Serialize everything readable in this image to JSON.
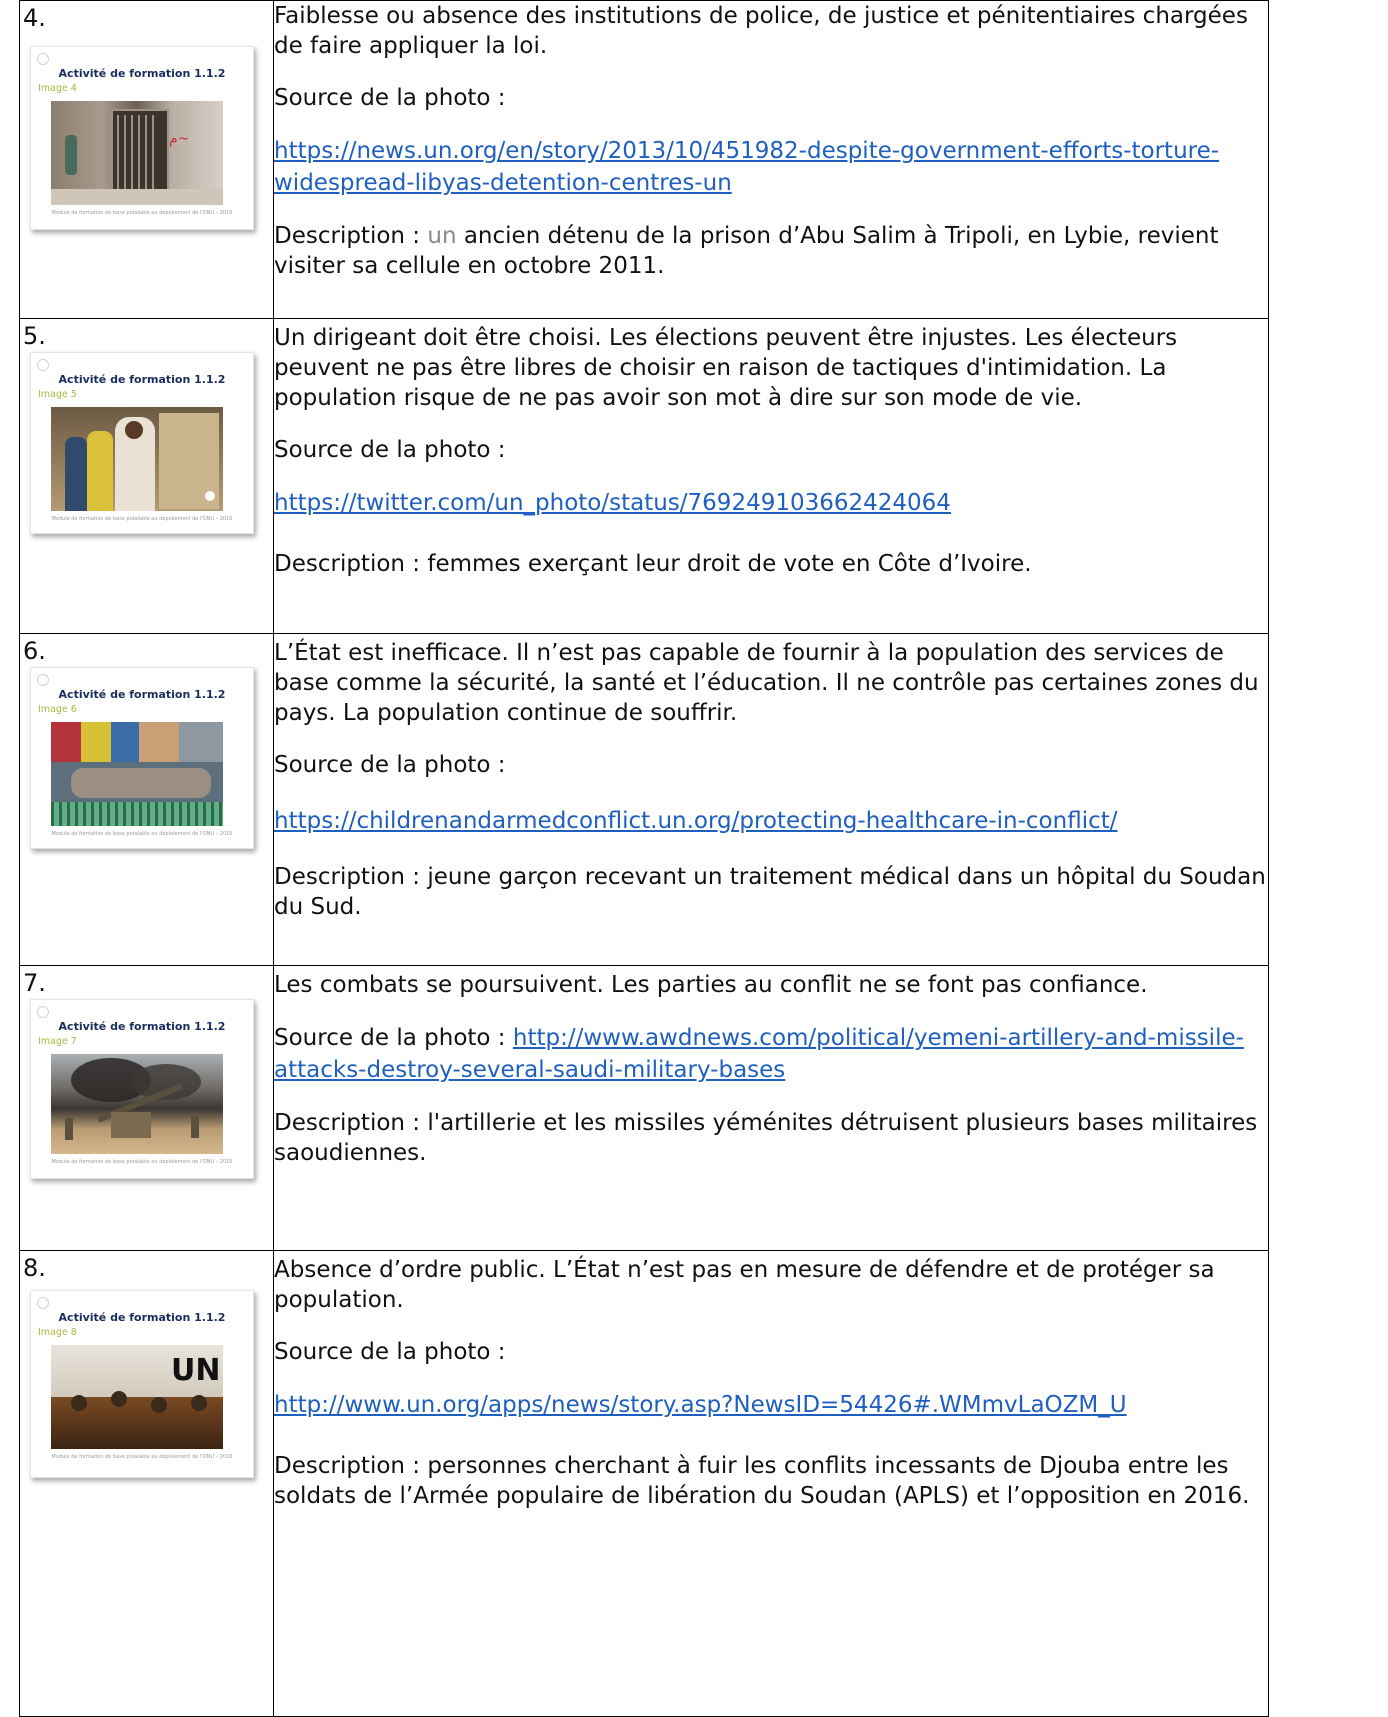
{
  "rows": [
    {
      "num": "4.",
      "slide": {
        "title": "Activité de formation 1.1.2",
        "caption": "Image 4",
        "footer": "Module de formation de base préalable au déploiement de l'ONU – 2016"
      },
      "text": "Faiblesse ou absence des institutions de police, de justice et pénitentiaires chargées de faire appliquer la loi.",
      "source_label": "Source de la photo :",
      "link": " https://news.un.org/en/story/2013/10/451982-despite-government-efforts-torture-widespread-libyas-detention-centres-un",
      "desc_prefix": "Description : ",
      "desc_gray": "un",
      "desc": " ancien détenu de la prison d’Abu Salim à Tripoli, en Lybie, revient visiter sa cellule en octobre 2011."
    },
    {
      "num": "5.",
      "slide": {
        "title": "Activité de formation 1.1.2",
        "caption": "Image 5",
        "footer": "Module de formation de base préalable au déploiement de l'ONU – 2016"
      },
      "text": "Un dirigeant doit être choisi. Les élections peuvent être injustes. Les électeurs peuvent ne pas être libres de choisir en raison de tactiques d'intimidation. La population risque de ne pas avoir son mot à dire sur son mode de vie.",
      "source_label": "Source de la photo :",
      "link": "https://twitter.com/un_photo/status/769249103662424064",
      "desc": "Description : femmes exerçant leur droit de vote en Côte d’Ivoire."
    },
    {
      "num": "6.",
      "slide": {
        "title": "Activité de formation 1.1.2",
        "caption": "Image 6",
        "footer": "Module de formation de base préalable au déploiement de l'ONU – 2016"
      },
      "text": "L’État est inefficace. Il n’est pas capable de fournir à la population des services de base comme la sécurité, la santé et l’éducation. Il ne contrôle pas certaines zones du pays. La population continue de souffrir.",
      "source_label": "Source de la photo :",
      "link": "https://childrenandarmedconflict.un.org/protecting-healthcare-in-conflict/",
      "desc": "Description : jeune garçon recevant un traitement médical dans un hôpital du Soudan du Sud."
    },
    {
      "num": "7.",
      "slide": {
        "title": "Activité de formation 1.1.2",
        "caption": "Image 7",
        "footer": "Module de formation de base préalable au déploiement de l'ONU – 2016"
      },
      "text": "Les combats se poursuivent. Les parties au conflit ne se font pas confiance.",
      "source_label": "Source de la photo :",
      "link": " http://www.awdnews.com/political/yemeni-artillery-and-missile-attacks-destroy-several-saudi-military-bases",
      "desc": "Description : l'artillerie et les missiles yéménites détruisent plusieurs bases militaires saoudiennes."
    },
    {
      "num": "8.",
      "slide": {
        "title": "Activité de formation 1.1.2",
        "caption": "Image 8",
        "footer": "Module de formation de base préalable au déploiement de l'ONU – 2016"
      },
      "text": "Absence d’ordre public. L’État n’est pas en mesure de défendre et de protéger sa population.",
      "source_label": "Source de la photo :",
      "link": "http://www.un.org/apps/news/story.asp?NewsID=54426#.WMmvLaOZM_U",
      "desc": "Description : personnes cherchant à fuir les conflits incessants de Djouba entre les soldats de l’Armée populaire de libération du Soudan (APLS) et l’opposition en 2016."
    }
  ]
}
